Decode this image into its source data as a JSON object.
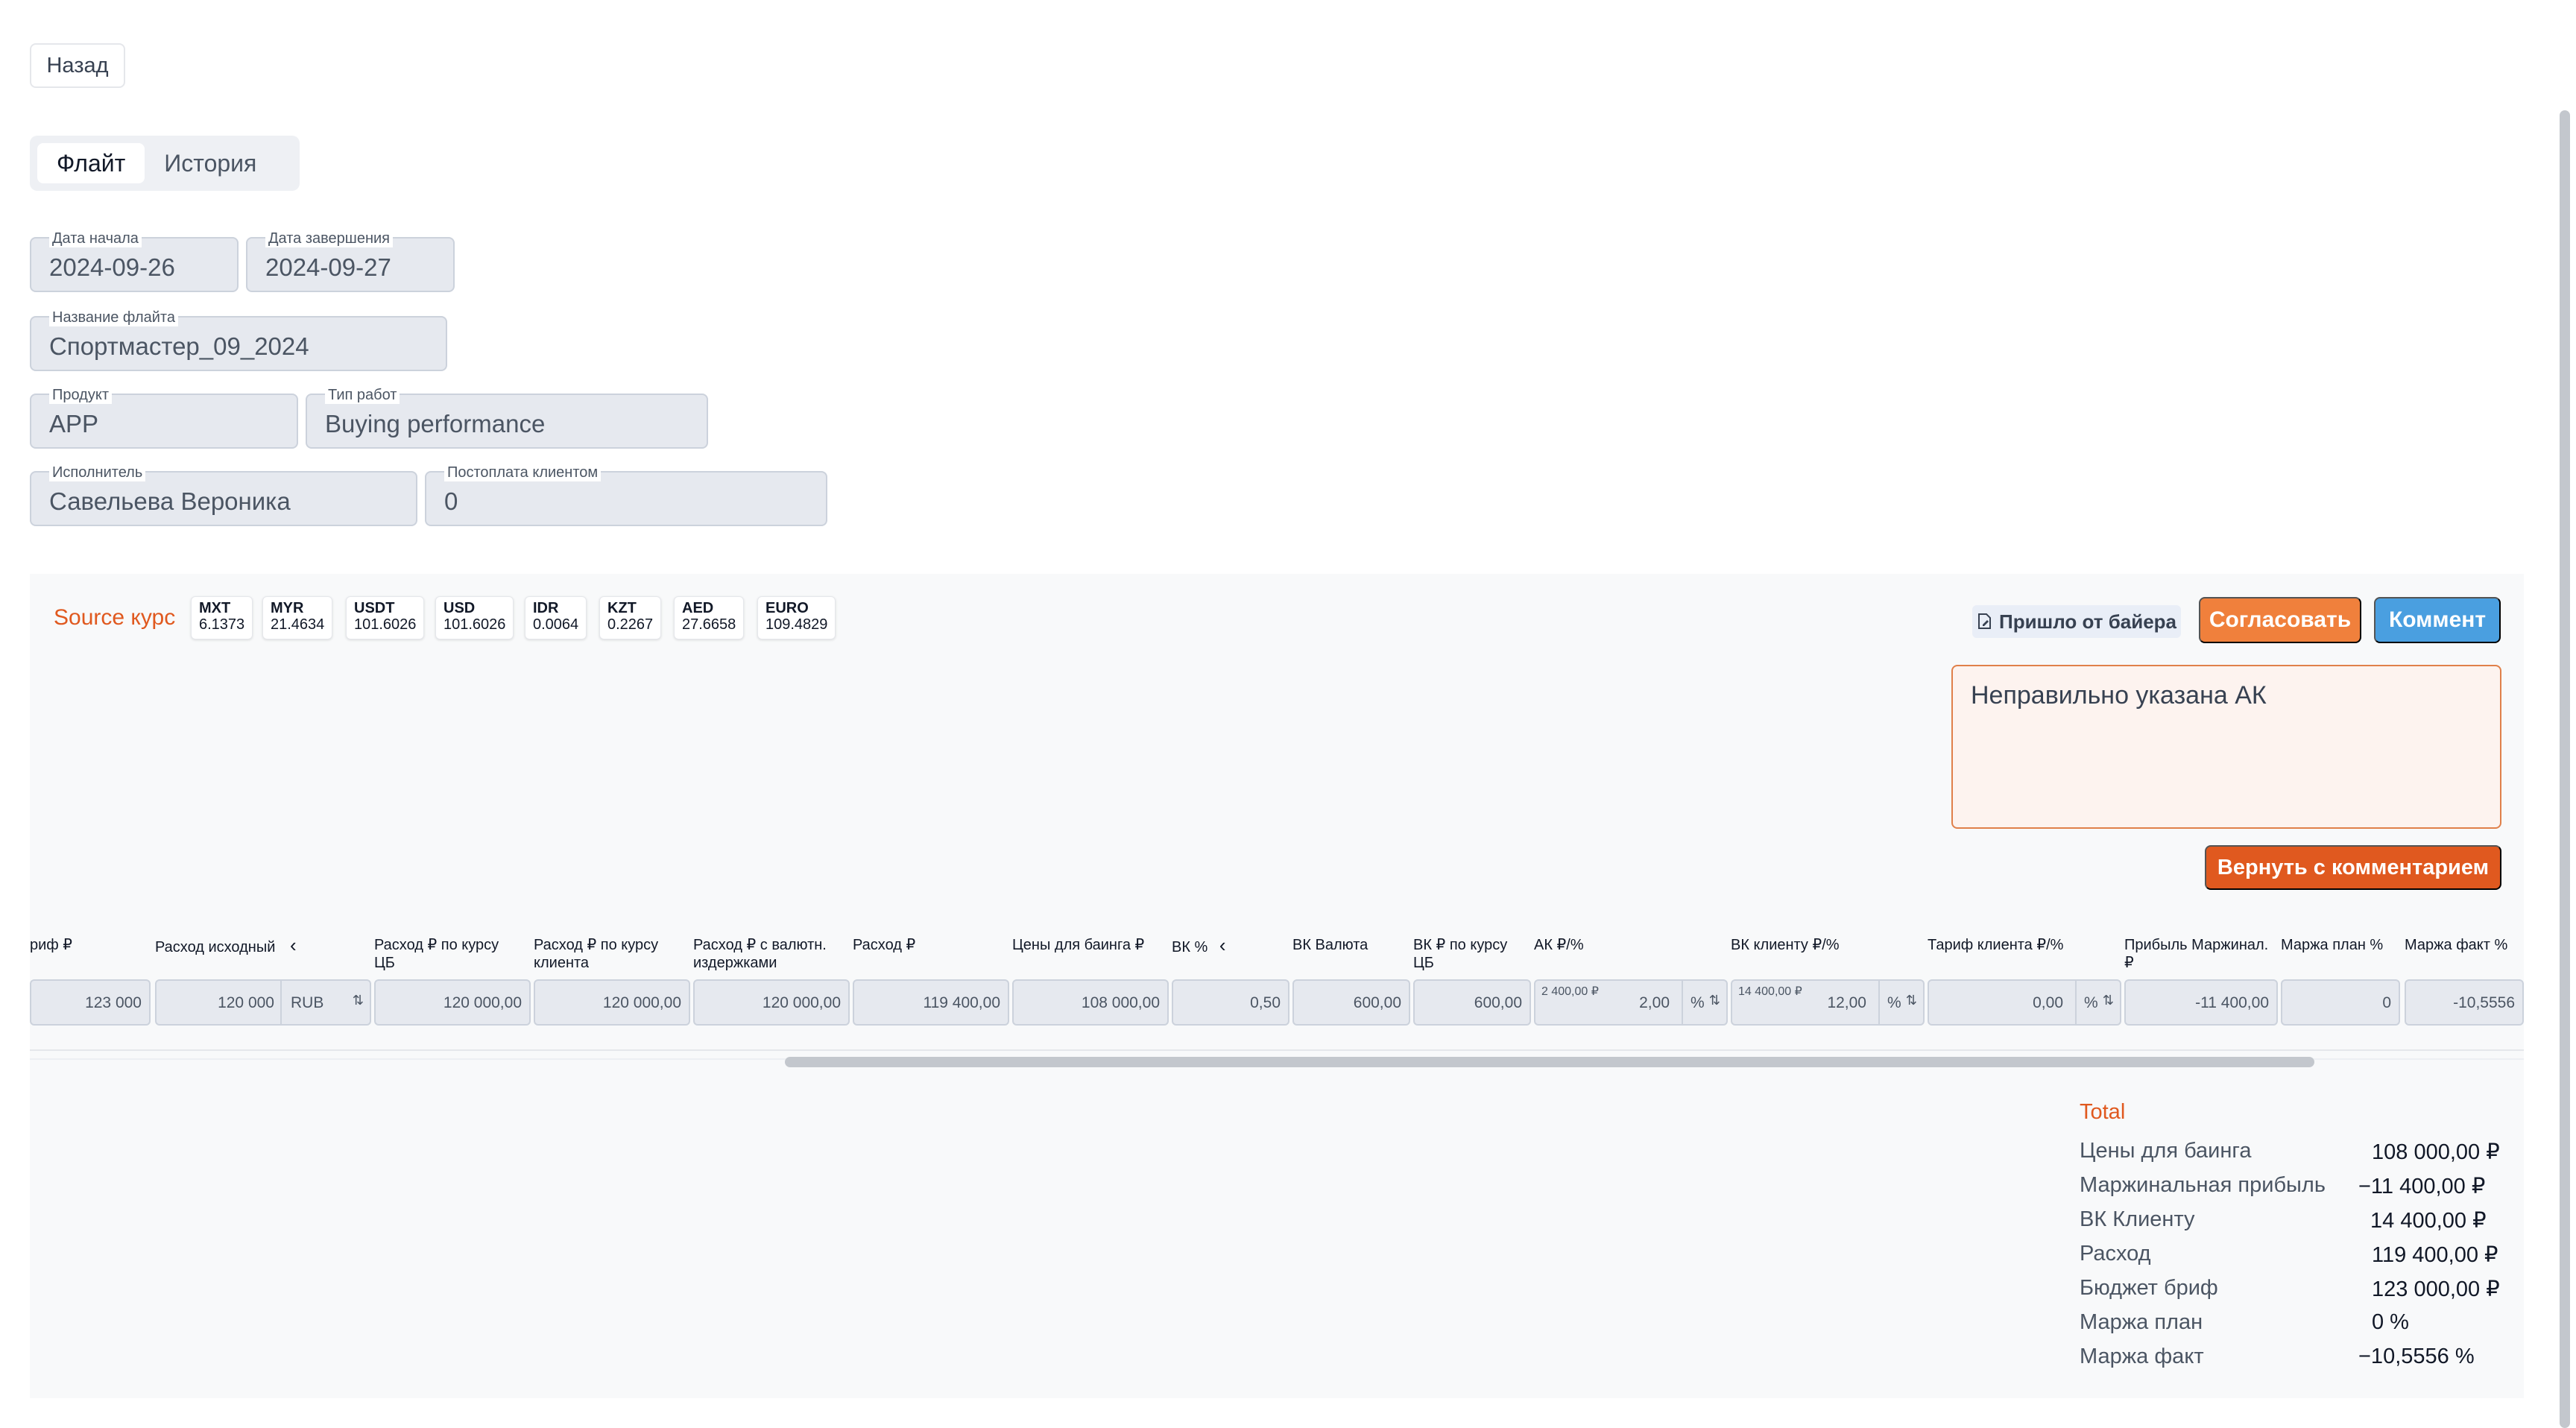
{
  "back_button": "Назад",
  "tabs": [
    {
      "label": "Флайт",
      "active": true
    },
    {
      "label": "История",
      "active": false
    }
  ],
  "fields": {
    "start_date": {
      "label": "Дата начала",
      "value": "2024-09-26"
    },
    "end_date": {
      "label": "Дата завершения",
      "value": "2024-09-27"
    },
    "flight_name": {
      "label": "Название флайта",
      "value": "Спортмастер_09_2024"
    },
    "product": {
      "label": "Продукт",
      "value": "APP"
    },
    "work_type": {
      "label": "Тип работ",
      "value": "Buying performance"
    },
    "executor": {
      "label": "Исполнитель",
      "value": "Савельева Вероника"
    },
    "postpay": {
      "label": "Постоплата клиентом",
      "value": "0"
    }
  },
  "source_rates": {
    "label": "Source курс",
    "rates": [
      {
        "code": "MXT",
        "value": "6.1373"
      },
      {
        "code": "MYR",
        "value": "21.4634"
      },
      {
        "code": "USDT",
        "value": "101.6026"
      },
      {
        "code": "USD",
        "value": "101.6026"
      },
      {
        "code": "IDR",
        "value": "0.0064"
      },
      {
        "code": "KZT",
        "value": "0.2267"
      },
      {
        "code": "AED",
        "value": "27.6658"
      },
      {
        "code": "EURO",
        "value": "109.4829"
      }
    ]
  },
  "actions": {
    "from_buyer": "Пришло от байера",
    "approve": "Согласовать",
    "comment": "Коммент",
    "return_with_comment": "Вернуть с комментарием"
  },
  "comment_text": "Неправильно указана АК",
  "table": {
    "headers": {
      "tariff": "риф ₽",
      "expense_src": "Расход исходный",
      "expense_cb_1": "Расход ₽ по курсу",
      "expense_cb_2": "ЦБ",
      "expense_client_1": "Расход ₽ по курсу",
      "expense_client_2": "клиента",
      "expense_costs_1": "Расход ₽ с валютн.",
      "expense_costs_2": "издержками",
      "expense": "Расход ₽",
      "buying_price": "Цены для баинга ₽",
      "vk_pct": "ВК %",
      "vk_currency": "ВК Валюта",
      "vk_cb_1": "ВК ₽ по курсу",
      "vk_cb_2": "ЦБ",
      "ak": "АК ₽/%",
      "vk_client": "ВК клиенту ₽/%",
      "client_tariff": "Тариф клиента ₽/%",
      "profit_1": "Прибыль Маржинал.",
      "profit_2": "₽",
      "margin_plan": "Маржа план %",
      "margin_fact": "Маржа факт %"
    },
    "row": {
      "tariff": "123 000",
      "expense_src": "120 000",
      "expense_src_currency": "RUB",
      "expense_cb": "120 000,00",
      "expense_client": "120 000,00",
      "expense_costs": "120 000,00",
      "expense": "119 400,00",
      "buying_price": "108 000,00",
      "vk_pct": "0,50",
      "vk_currency": "600,00",
      "vk_cb": "600,00",
      "ak_sub": "2 400,00 ₽",
      "ak": "2,00",
      "ak_unit": "%",
      "vk_client_sub": "14 400,00 ₽",
      "vk_client": "12,00",
      "vk_client_unit": "%",
      "client_tariff": "0,00",
      "client_tariff_unit": "%",
      "profit": "-11 400,00",
      "margin_plan": "0",
      "margin_fact": "-10,5556"
    }
  },
  "total": {
    "title": "Total",
    "rows": [
      {
        "label": "Цены для баинга",
        "value": "108 000,00 ₽"
      },
      {
        "label": "Маржинальная прибыль",
        "value": "−11 400,00 ₽"
      },
      {
        "label": "ВК Клиенту",
        "value": "14 400,00 ₽"
      },
      {
        "label": "Расход",
        "value": "119 400,00 ₽"
      },
      {
        "label": "Бюджет бриф",
        "value": "123 000,00 ₽"
      },
      {
        "label": "Маржа план",
        "value": "0 %"
      },
      {
        "label": "Маржа факт",
        "value": "−10,5556 %"
      }
    ]
  }
}
